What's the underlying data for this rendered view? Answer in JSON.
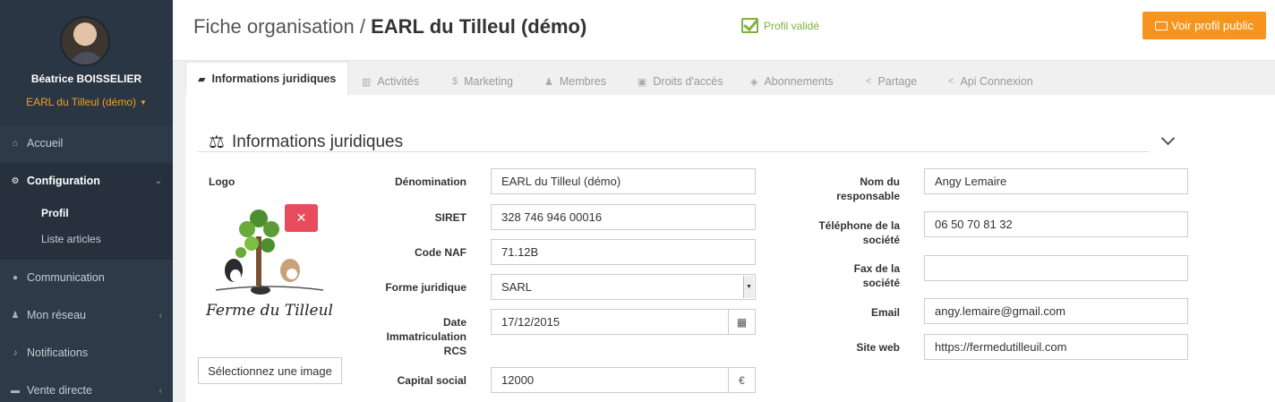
{
  "user": {
    "name": "Béatrice BOISSELIER",
    "organization": "EARL du Tilleul (démo)"
  },
  "sidebar": {
    "items": [
      {
        "label": "Accueil",
        "icon": "home-icon"
      },
      {
        "label": "Configuration",
        "icon": "gears-icon",
        "expanded": true
      },
      {
        "label": "Communication",
        "icon": "comments-icon"
      },
      {
        "label": "Mon réseau",
        "icon": "users-icon"
      },
      {
        "label": "Notifications",
        "icon": "bell-icon"
      },
      {
        "label": "Vente directe",
        "icon": "cart-icon"
      }
    ],
    "subitems": [
      {
        "label": "Profil",
        "current": true
      },
      {
        "label": "Liste articles"
      }
    ]
  },
  "header": {
    "title_prefix": "Fiche organisation / ",
    "title_org": "EARL du Tilleul (démo)",
    "status": "Profil validé",
    "public_button": "Voir profil public"
  },
  "tabs": [
    {
      "label": "Informations juridiques",
      "icon": "folder-open-icon",
      "active": true
    },
    {
      "label": "Activités",
      "icon": "bar-chart-icon"
    },
    {
      "label": "Marketing",
      "icon": "dollar-icon"
    },
    {
      "label": "Membres",
      "icon": "users-icon"
    },
    {
      "label": "Droits d'accès",
      "icon": "lock-icon"
    },
    {
      "label": "Abonnements",
      "icon": "tag-icon"
    },
    {
      "label": "Partage",
      "icon": "share-icon"
    },
    {
      "label": "Api Connexion",
      "icon": "share-icon"
    }
  ],
  "section": {
    "title": "Informations juridiques"
  },
  "logo": {
    "label": "Logo",
    "upload_button": "Sélectionnez une image",
    "logo_text": "Ferme du Tilleul"
  },
  "form": {
    "denomination": {
      "label": "Dénomination",
      "value": "EARL du Tilleul (démo)"
    },
    "siret": {
      "label": "SIRET",
      "value": "328 746 946 00016"
    },
    "naf": {
      "label": "Code NAF",
      "value": "71.12B"
    },
    "forme": {
      "label": "Forme juridique",
      "value": "SARL"
    },
    "date_rcs": {
      "label_line1": "Date",
      "label_line2": "Immatriculation",
      "label_line3": "RCS",
      "value": "17/12/2015"
    },
    "capital": {
      "label": "Capital social",
      "value": "12000",
      "unit": "€"
    },
    "responsable": {
      "label_line1": "Nom du",
      "label_line2": "responsable",
      "value": "Angy Lemaire"
    },
    "telephone": {
      "label_line1": "Téléphone de la",
      "label_line2": "société",
      "value": "06 50 70 81 32"
    },
    "fax": {
      "label_line1": "Fax de la",
      "label_line2": "société",
      "value": ""
    },
    "email": {
      "label": "Email",
      "value": "angy.lemaire@gmail.com"
    },
    "site": {
      "label": "Site web",
      "value": "https://fermedutilleuil.com"
    }
  },
  "colors": {
    "accent": "#f7941d",
    "sidebar": "#2e3a47",
    "valid": "#7cb33b",
    "delete": "#e74c5c"
  }
}
